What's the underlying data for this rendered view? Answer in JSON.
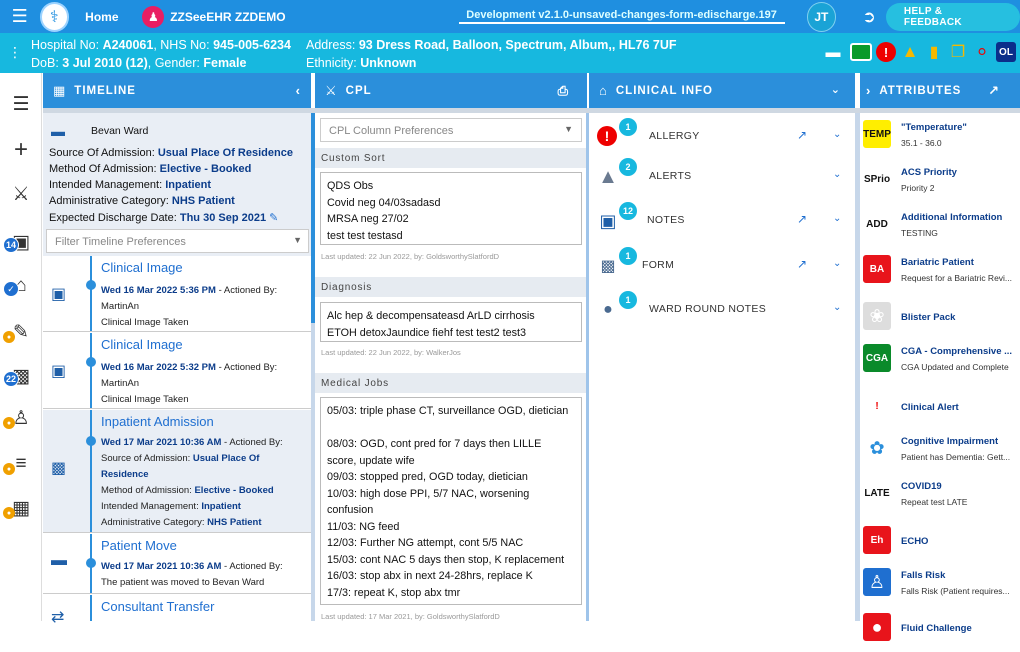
{
  "topbar": {
    "home_label": "Home",
    "patient_label": "ZZSeeEHR ZZDEMO",
    "environment": "Development v2.1.0-unsaved-changes-form-edischarge.197",
    "user_initials": "JT",
    "help_label": "HELP & FEEDBACK"
  },
  "banner": {
    "hospital_no_label": "Hospital No:",
    "hospital_no": "A240061",
    "nhs_no_label": "NHS No:",
    "nhs_no": "945-005-6234",
    "address_label": "Address:",
    "address": "93 Dress Road, Balloon, Spectrum, Album,, HL76 7UF",
    "dob_label": "DoB:",
    "dob": "3 Jul 2010 (12)",
    "gender_label": "Gender:",
    "gender": "Female",
    "ethnicity_label": "Ethnicity:",
    "ethnicity": "Unknown",
    "icons": [
      "bed-icon",
      "green-flag-icon",
      "alert-circle-icon",
      "warning-icon",
      "clipboard-icon",
      "documents-icon",
      "pill-icon",
      "ol-badge-icon"
    ],
    "ol_label": "OL"
  },
  "leftnav": {
    "badge_camera": "14",
    "badge_clipboard": "22"
  },
  "timeline": {
    "title": "TIMELINE",
    "ward": "Bevan Ward",
    "source_label": "Source Of Admission:",
    "source": "Usual Place Of Residence",
    "method_label": "Method Of Admission:",
    "method": "Elective - Booked",
    "intended_label": "Intended Management:",
    "intended": "Inpatient",
    "admin_label": "Administrative Category:",
    "admin": "NHS Patient",
    "discharge_label": "Expected Discharge Date:",
    "discharge": "Thu 30 Sep 2021",
    "filter_placeholder": "Filter Timeline Preferences",
    "events": [
      {
        "title": "Clinical Image",
        "date": "Wed 16 Mar 2022 5:36 PM",
        "actioned_label": "- Actioned By:",
        "actioned_by": "MartinAn",
        "detail": "Clinical Image Taken"
      },
      {
        "title": "Clinical Image",
        "date": "Wed 16 Mar 2022 5:32 PM",
        "actioned_label": "- Actioned By:",
        "actioned_by": "MartinAn",
        "detail": "Clinical Image Taken"
      },
      {
        "title": "Inpatient Admission",
        "date": "Wed 17 Mar 2021 10:36 AM",
        "actioned_label": "- Actioned By:",
        "source_label": "Source of Admission:",
        "source": "Usual Place Of",
        "source2": "Residence",
        "method_label": "Method of Admission:",
        "method": "Elective - Booked",
        "intended_label": "Intended Management:",
        "intended": "Inpatient",
        "admin_label": "Administrative Category:",
        "admin": "NHS Patient"
      },
      {
        "title": "Patient Move",
        "date": "Wed 17 Mar 2021 10:36 AM",
        "actioned_label": "- Actioned By:",
        "detail": "The patient was moved to Bevan Ward"
      },
      {
        "title": "Consultant Transfer"
      }
    ]
  },
  "cpl": {
    "title": "CPL",
    "column_prefs_placeholder": "CPL Column Preferences",
    "sections": [
      {
        "label": "Custom Sort",
        "text": "QDS Obs\nCovid neg 04/03sadasd\nMRSA neg 27/02\ntest test testasd",
        "updated": "Last updated: 22 Jun 2022, by: GoldsworthySlatfordD"
      },
      {
        "label": "Diagnosis",
        "text": "Alc hep & decompensateasd ArLD cirrhosis\nETOH detoxJaundice fiehf test test2 test3",
        "updated": "Last updated: 22 Jun 2022, by: WalkerJos"
      },
      {
        "label": "Medical Jobs",
        "text": "05/03: triple phase CT, surveillance OGD, dietician\n\n08/03: OGD, cont pred for 7 days then LILLE\nscore, update wife\n09/03: stopped pred, OGD today, dietician\n10/03: high dose PPI, 5/7 NAC, worsening\nconfusion\n11/03: NG feed\n12/03: Further NG attempt, cont 5/5 NAC\n15/03: cont NAC 5 days then stop, K replacement\n16/03: stop abx in next 24-28hrs, replace K\n17/3: repeat K, stop abx tmr",
        "updated": "Last updated: 17 Mar 2021, by: GoldsworthySlatfordD"
      }
    ]
  },
  "clinical_info": {
    "title": "CLINICAL INFO",
    "items": [
      {
        "label": "ALLERGY",
        "count": "1"
      },
      {
        "label": "ALERTS",
        "count": "2"
      },
      {
        "label": "NOTES",
        "count": "12"
      },
      {
        "label": "FORM",
        "count": "1"
      },
      {
        "label": "WARD ROUND NOTES",
        "count": "1"
      }
    ]
  },
  "attributes": {
    "title": "ATTRIBUTES",
    "items": [
      {
        "avatar": "TEMP",
        "name": "\"Temperature\"",
        "desc": "35.1 - 36.0",
        "color": "#ffee00"
      },
      {
        "avatar": "SPrio",
        "name": "ACS Priority",
        "desc": "Priority 2",
        "color": "#ffffff"
      },
      {
        "avatar": "ADD",
        "name": "Additional Information",
        "desc": "TESTING",
        "color": "#ffffff"
      },
      {
        "avatar": "BA",
        "name": "Bariatric Patient",
        "desc": "Request for a Bariatric Revi...",
        "color": "#e8141b"
      },
      {
        "avatar": "",
        "name": "Blister Pack",
        "desc": "",
        "color": "#dddddd"
      },
      {
        "avatar": "CGA",
        "name": "CGA - Comprehensive ...",
        "desc": "CGA Updated and Complete",
        "color": "#0a8a2a"
      },
      {
        "avatar": "!",
        "name": "Clinical Alert",
        "desc": "",
        "color": "#ffffff"
      },
      {
        "avatar": "",
        "name": "Cognitive Impairment",
        "desc": "Patient has Dementia: Gett...",
        "color": "#ffffff"
      },
      {
        "avatar": "LATE",
        "name": "COVID19",
        "desc": "Repeat test LATE",
        "color": "#ffffff"
      },
      {
        "avatar": "Eh",
        "name": "ECHO",
        "desc": "",
        "color": "#e8141b"
      },
      {
        "avatar": "",
        "name": "Falls Risk",
        "desc": "Falls Risk (Patient requires...",
        "color": "#1f6fd0"
      },
      {
        "avatar": "",
        "name": "Fluid Challenge",
        "desc": "",
        "color": "#e8141b"
      }
    ]
  }
}
